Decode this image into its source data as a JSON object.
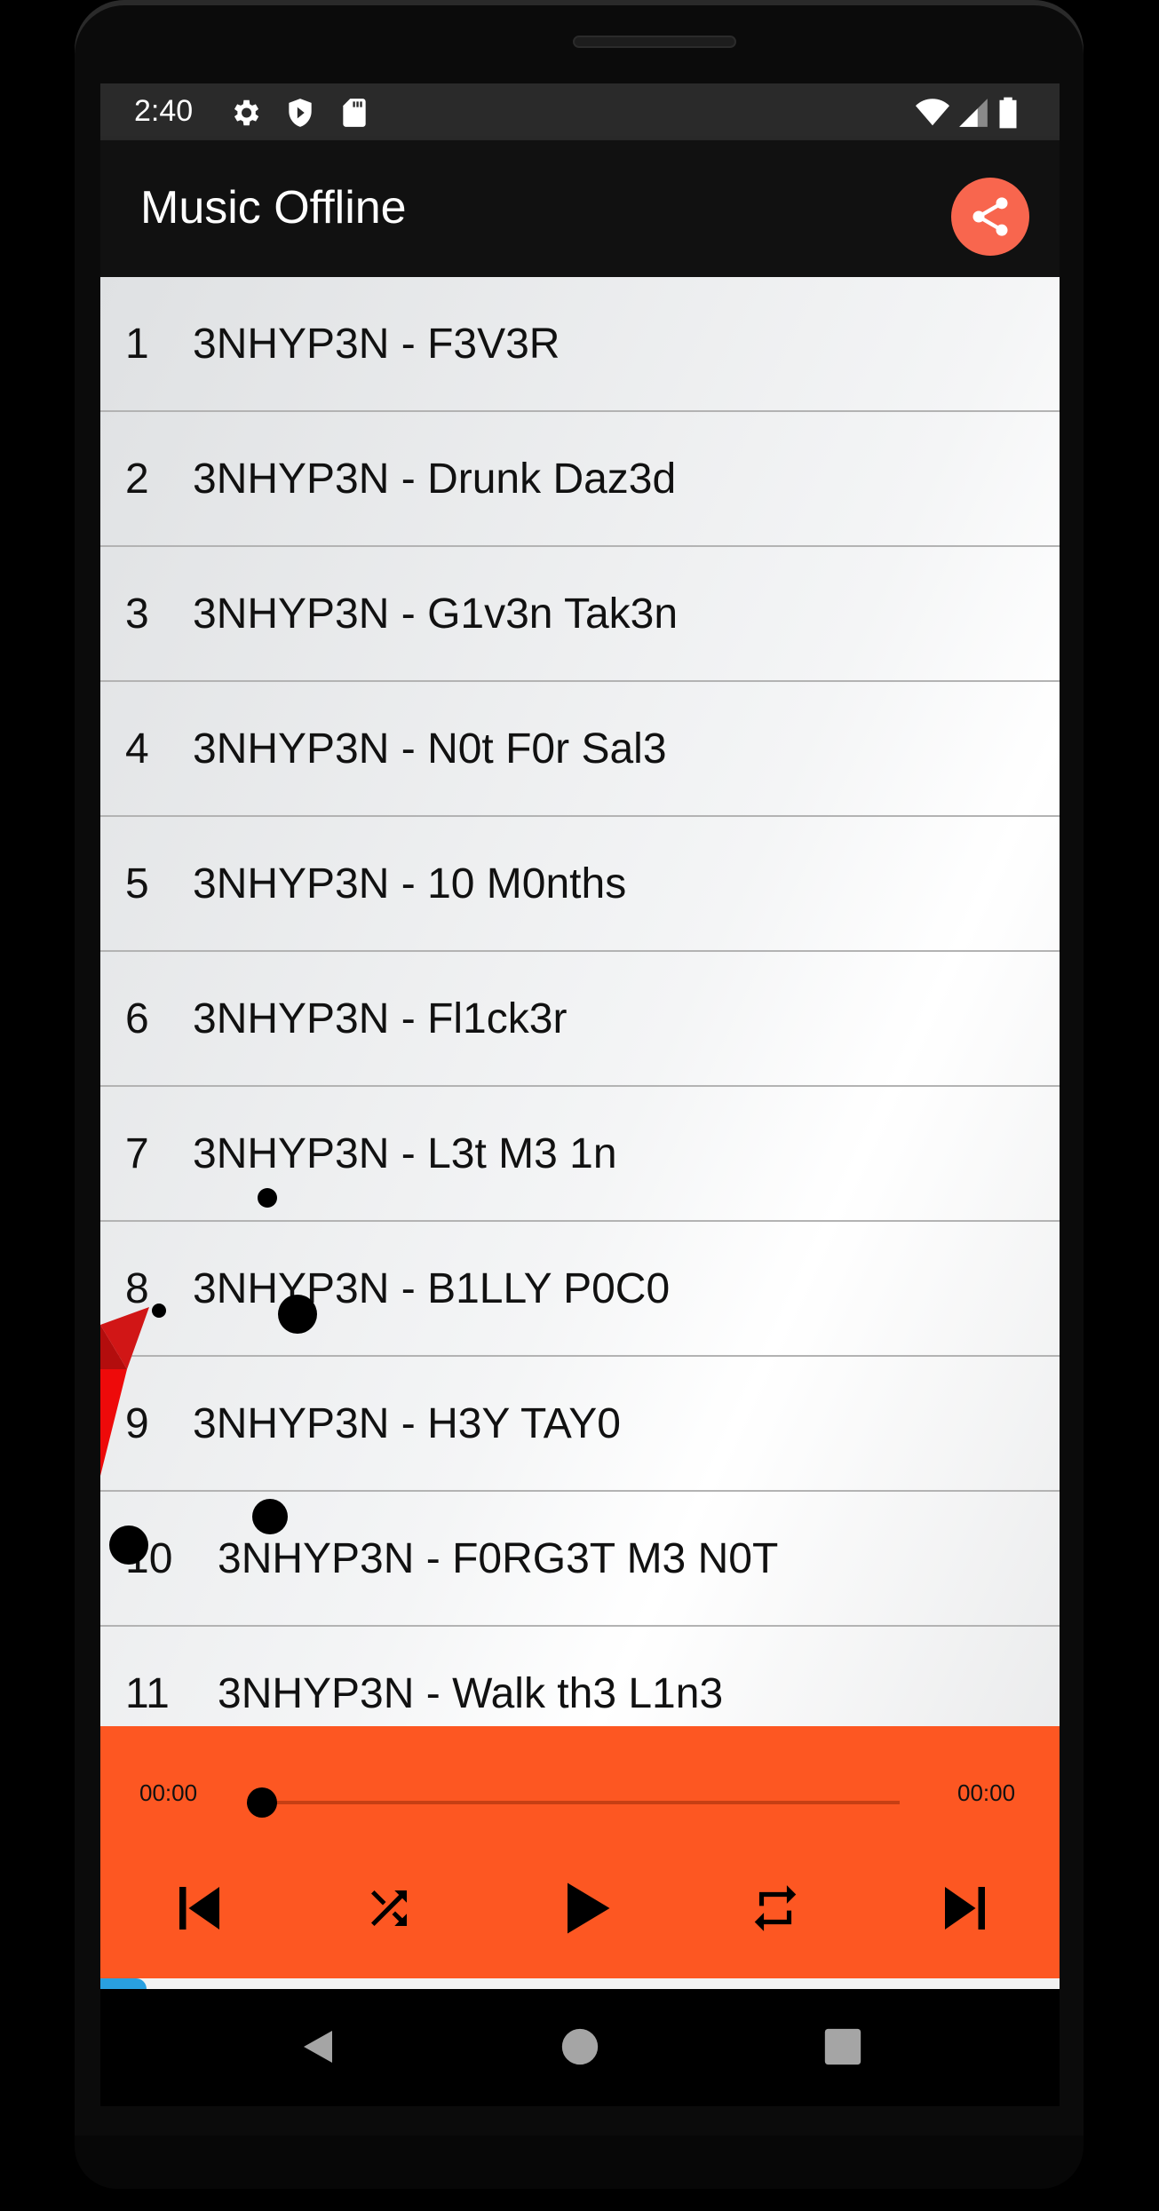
{
  "statusbar": {
    "time": "2:40",
    "left_icons": [
      "gear-icon",
      "shield-play-icon",
      "sd-card-icon"
    ],
    "right_icons": [
      "wifi-icon",
      "cell-signal-icon",
      "battery-icon"
    ]
  },
  "appbar": {
    "title": "Music Offline",
    "share_icon": "share-icon",
    "accent_color": "#f8664e"
  },
  "tracks": [
    {
      "num": "1",
      "title": "3NHYP3N - F3V3R"
    },
    {
      "num": "2",
      "title": "3NHYP3N - Drunk Daz3d"
    },
    {
      "num": "3",
      "title": "3NHYP3N - G1v3n Tak3n"
    },
    {
      "num": "4",
      "title": "3NHYP3N - N0t F0r Sal3"
    },
    {
      "num": "5",
      "title": "3NHYP3N - 10 M0nths"
    },
    {
      "num": "6",
      "title": "3NHYP3N - Fl1ck3r"
    },
    {
      "num": "7",
      "title": "3NHYP3N - L3t M3 1n"
    },
    {
      "num": "8",
      "title": "3NHYP3N - B1LLY P0C0"
    },
    {
      "num": "9",
      "title": "3NHYP3N - H3Y TAY0"
    },
    {
      "num": "10",
      "title": "3NHYP3N - F0RG3T M3 N0T"
    },
    {
      "num": "11",
      "title": "3NHYP3N - Walk th3 L1n3"
    }
  ],
  "player": {
    "current_time": "00:00",
    "total_time": "00:00",
    "progress": 0,
    "background_color": "#fd5722",
    "controls": [
      "skip-previous-icon",
      "shuffle-icon",
      "play-icon",
      "repeat-icon",
      "skip-next-icon"
    ]
  },
  "navbar": {
    "icons": [
      "back-icon",
      "home-icon",
      "recents-icon"
    ]
  }
}
